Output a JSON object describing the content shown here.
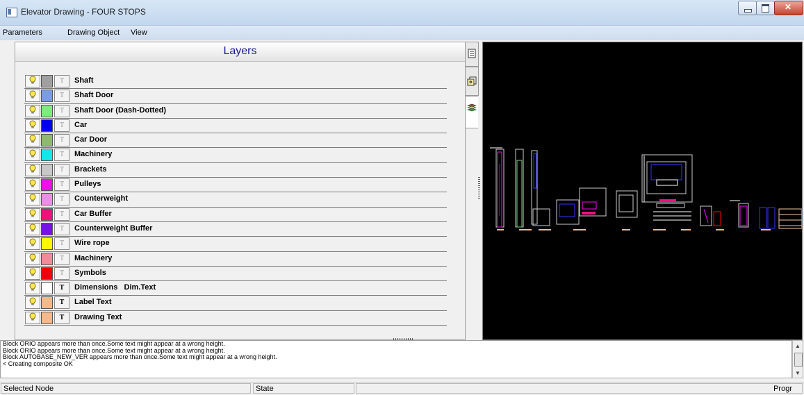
{
  "window": {
    "title": "Elevator Drawing - FOUR STOPS"
  },
  "menu": [
    "Parameters",
    "Drawing Object",
    "View"
  ],
  "layers_panel": {
    "title": "Layers",
    "layers": [
      {
        "name": "Shaft",
        "color": "#a0a0a0",
        "text_enabled": false
      },
      {
        "name": "Shaft Door",
        "color": "#7a9ce8",
        "text_enabled": false
      },
      {
        "name": "Shaft Door (Dash-Dotted)",
        "color": "#79ee79",
        "text_enabled": false
      },
      {
        "name": "Car",
        "color": "#0000f0",
        "text_enabled": false
      },
      {
        "name": "Car Door",
        "color": "#8fba6a",
        "text_enabled": false
      },
      {
        "name": "Machinery",
        "color": "#10e8ee",
        "text_enabled": false
      },
      {
        "name": "Brackets",
        "color": "#c8c8c8",
        "text_enabled": false
      },
      {
        "name": "Pulleys",
        "color": "#f010e8",
        "text_enabled": false
      },
      {
        "name": "Counterweight",
        "color": "#f08ce8",
        "text_enabled": false
      },
      {
        "name": "Car Buffer",
        "color": "#f0107a",
        "text_enabled": false
      },
      {
        "name": "Counterweight Buffer",
        "color": "#7a10e8",
        "text_enabled": false
      },
      {
        "name": "Wire rope",
        "color": "#f8f800",
        "text_enabled": false
      },
      {
        "name": "Machinery",
        "color": "#f08c9a",
        "text_enabled": false
      },
      {
        "name": "Symbols",
        "color": "#f00000",
        "text_enabled": false
      },
      {
        "name": "Dimensions   Dim.Text",
        "color": "#ffffff",
        "text_enabled": true
      },
      {
        "name": "Label Text",
        "color": "#f8b888",
        "text_enabled": true
      },
      {
        "name": "Drawing Text",
        "color": "#f8b888",
        "text_enabled": true
      }
    ]
  },
  "side_tabs": [
    {
      "name": "document",
      "icon": "document-icon"
    },
    {
      "name": "export",
      "icon": "export-icon"
    },
    {
      "name": "layers",
      "icon": "layers-icon"
    }
  ],
  "log": {
    "lines": [
      "Block ORIO appears more than once.Some text might appear at a wrong height.",
      "Block ORIO appears more than once.Some text might appear at a wrong height.",
      "Block AUTOBASE_NEW_VER appears more than once.Some text might appear at a wrong height.",
      "< Creating composite OK"
    ]
  },
  "status": {
    "selected_node": "Selected Node",
    "state": "State",
    "progress": "Progr"
  }
}
